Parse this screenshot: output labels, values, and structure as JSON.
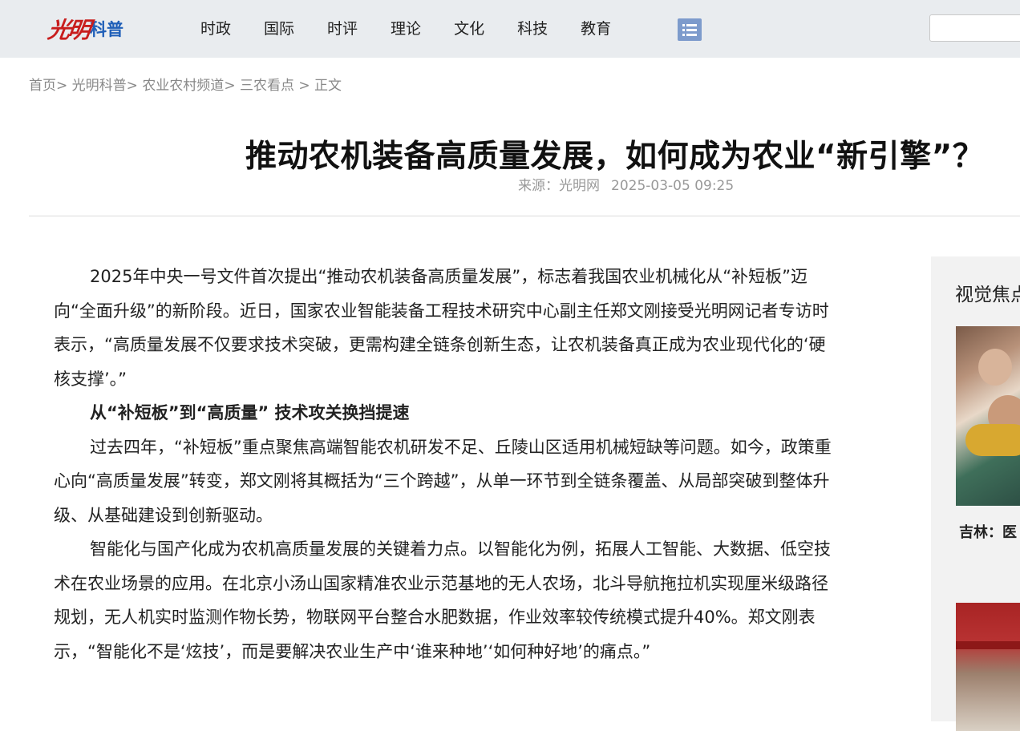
{
  "header": {
    "logo_script": "光明",
    "logo_text": "科普",
    "nav": [
      "时政",
      "国际",
      "时评",
      "理论",
      "文化",
      "科技",
      "教育"
    ],
    "menu_icon": "list-menu-icon",
    "search_placeholder": ""
  },
  "breadcrumb": {
    "items": [
      "首页",
      "光明科普",
      "农业农村频道",
      "三农看点",
      "正文"
    ],
    "separators": [
      ">",
      ">",
      ">",
      ">"
    ]
  },
  "article": {
    "title": "推动农机装备高质量发展，如何成为农业“新引擎”？",
    "source_label": "来源：光明网",
    "date": "2025-03-05 09:25",
    "paragraphs": [
      "2025年中央一号文件首次提出“推动农机装备高质量发展”，标志着我国农业机械化从“补短板”迈向“全面升级”的新阶段。近日，国家农业智能装备工程技术研究中心副主任郑文刚接受光明网记者专访时表示，“高质量发展不仅要求技术突破，更需构建全链条创新生态，让农机装备真正成为农业现代化的‘硬核支撑’。”",
      "从“补短板”到“高质量” 技术攻关换挡提速",
      "过去四年，“补短板”重点聚焦高端智能农机研发不足、丘陵山区适用机械短缺等问题。如今，政策重心向“高质量发展”转变，郑文刚将其概括为“三个跨越”，从单一环节到全链条覆盖、从局部突破到整体升级、从基础建设到创新驱动。",
      "智能化与国产化成为农机高质量发展的关键着力点。以智能化为例，拓展人工智能、大数据、低空技术在农业场景的应用。在北京小汤山国家精准农业示范基地的无人农场，北斗导航拖拉机实现厘米级路径规划，无人机实时监测作物长势，物联网平台整合水肥数据，作业效率较传统模式提升40%。郑文刚表示，“智能化不是‘炫技’，而是要解决农业生产中‘谁来种地’‘如何种好地’的痛点。”"
    ]
  },
  "sidebar": {
    "title": "视觉焦点",
    "items": [
      {
        "caption": "吉林：医"
      },
      {
        "caption": ""
      }
    ]
  },
  "colors": {
    "topbar_bg": "#e9ecef",
    "logo_red": "#c81d1d",
    "logo_blue": "#1f5fb8",
    "menu_btn": "#7d9bcc",
    "sidebar_bg": "#f2f2f2"
  }
}
